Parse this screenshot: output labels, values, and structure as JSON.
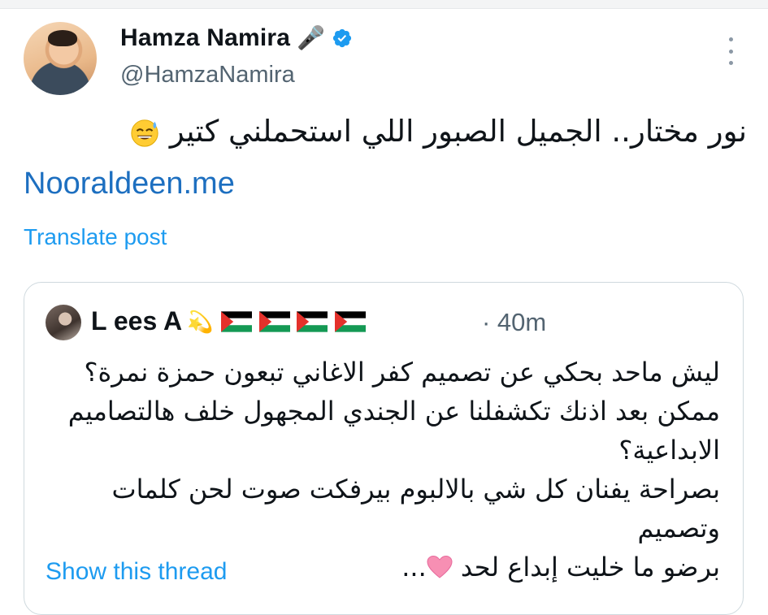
{
  "tweet": {
    "author": {
      "display_name": "Hamza Namira",
      "mic_emoji": "🎤",
      "verified": true,
      "handle": "@HamzaNamira"
    },
    "text": "نور مختار.. الجميل الصبور اللي استحملني كتير",
    "emoji": "face-with-sweat-emoji",
    "link": "Nooraldeen.me",
    "translate_label": "Translate post",
    "menu_icon": "more-vertical-icon"
  },
  "quote": {
    "author": {
      "name": "L ees A",
      "emoji": "💫",
      "flags": [
        "palestine-flag",
        "palestine-flag",
        "palestine-flag",
        "palestine-flag"
      ]
    },
    "time": "· 40m",
    "text": "ليش ماحد بحكي عن تصميم كفر الاغاني تبعون حمزة نمرة؟\nممكن بعد اذنك تكشفلنا عن الجندي المجهول خلف هالتصاميم الابداعية؟\nبصراحة يفنان كل شي بالالبوم بيرفكت صوت لحن كلمات وتصميم\nبرضو ما خليت إبداع لحد",
    "trailing": "...",
    "heart_icon": "pink-heart-icon",
    "show_thread_label": "Show this thread"
  },
  "colors": {
    "link": "#1d6fc0",
    "accent": "#1d9bf0",
    "secondary_text": "#536471",
    "border": "#cfd9de"
  }
}
